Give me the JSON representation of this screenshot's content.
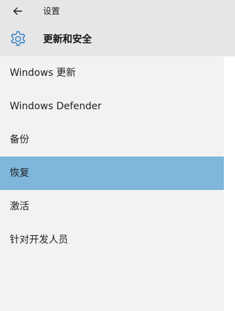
{
  "titlebar": {
    "back_icon": "back-arrow-icon",
    "app_title": "设置"
  },
  "header": {
    "icon": "gear-icon",
    "title": "更新和安全"
  },
  "nav": {
    "selected_color": "#7eb6dc",
    "background_color": "#f2f2f2",
    "items": [
      {
        "label": "Windows 更新",
        "selected": false
      },
      {
        "label": "Windows Defender",
        "selected": false
      },
      {
        "label": "备份",
        "selected": false
      },
      {
        "label": "恢复",
        "selected": true
      },
      {
        "label": "激活",
        "selected": false
      },
      {
        "label": "针对开发人员",
        "selected": false
      }
    ]
  }
}
